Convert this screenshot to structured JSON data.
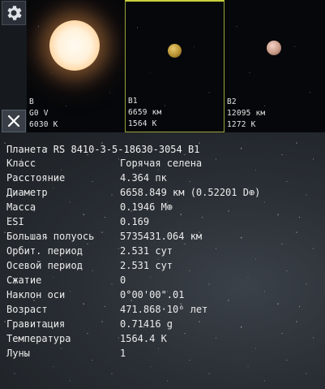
{
  "thumbnails": [
    {
      "name": "B",
      "line2": "G0 V",
      "line3": "6030 K"
    },
    {
      "name": "B1",
      "line2": "6659 км",
      "line3": "1564 K"
    },
    {
      "name": "B2",
      "line2": "12095 км",
      "line3": "1272 K"
    }
  ],
  "icons": {
    "settings": "gear-icon",
    "close": "close-icon"
  },
  "info": {
    "title": "Планета  RS 8410-3-5-18630-3054 B1",
    "rows": [
      {
        "key": "Класс",
        "value": "Горячая селена"
      },
      {
        "key": "Расстояние",
        "value": "4.364 пк"
      },
      {
        "key": "Диаметр",
        "value": "6658.849 км (0.52201 D⊕)"
      },
      {
        "key": "Масса",
        "value": "0.1946 M⊕"
      },
      {
        "key": "ESI",
        "value": "0.169"
      },
      {
        "key": "Большая полуось",
        "value": "5735431.064 км"
      },
      {
        "key": "Орбит. период",
        "value": "2.531 сут"
      },
      {
        "key": "Осевой период",
        "value": "2.531 сут"
      },
      {
        "key": "Сжатие",
        "value": "0"
      },
      {
        "key": "Наклон оси",
        "value": "0°00'00\".01"
      },
      {
        "key": "Возраст",
        "value": "471.868·10⁶ лет"
      },
      {
        "key": "Гравитация",
        "value": "0.71416 g"
      },
      {
        "key": "Температура",
        "value": "1564.4 K"
      },
      {
        "key": "Луны",
        "value": "1"
      }
    ]
  },
  "colors": {
    "selected_border": "#c7cf3d"
  }
}
